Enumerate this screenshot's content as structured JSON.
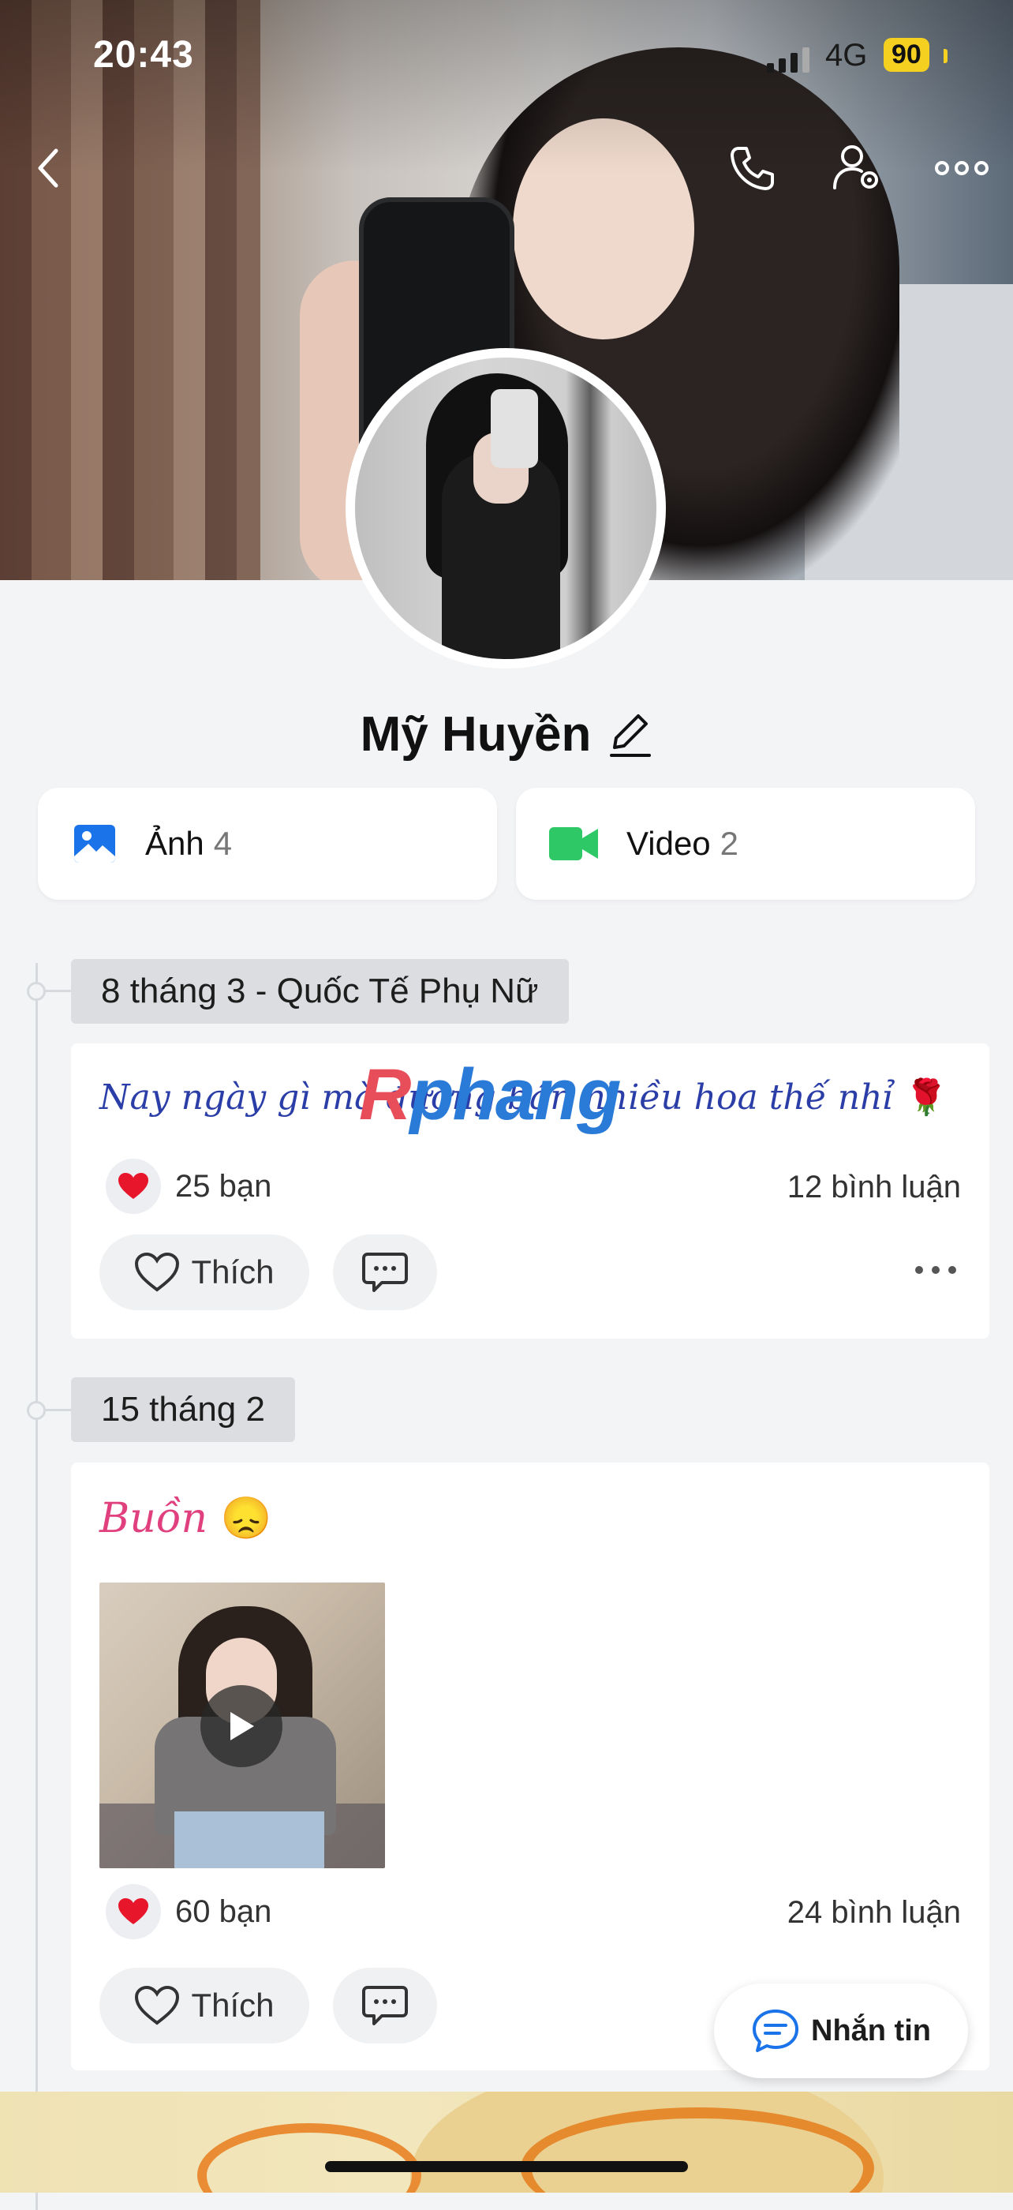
{
  "status_bar": {
    "time": "20:43",
    "network": "4G",
    "battery": "90"
  },
  "profile": {
    "name": "Mỹ Huyền"
  },
  "media": [
    {
      "label": "Ảnh",
      "count": "4"
    },
    {
      "label": "Video",
      "count": "2"
    }
  ],
  "watermark": {
    "part1": "R",
    "part2": "phang"
  },
  "posts": [
    {
      "date": "8 tháng 3 - Quốc Tế Phụ Nữ",
      "text": "Nay ngày gì mà đường bán nhiều hoa thế nhỉ",
      "emoji": "🌹",
      "likes": "25 bạn",
      "comments": "12 bình luận",
      "like_label": "Thích"
    },
    {
      "date": "15 tháng 2",
      "text": "Buồn",
      "emoji": "😞",
      "likes": "60 bạn",
      "comments": "24 bình luận",
      "like_label": "Thích"
    }
  ],
  "fab": {
    "label": "Nhắn tin"
  },
  "colors": {
    "accent": "#1a73e8",
    "video_green": "#2ec866",
    "heart": "#e8162b",
    "script_blue": "#2b3ea8",
    "script_pink": "#e0417e"
  }
}
